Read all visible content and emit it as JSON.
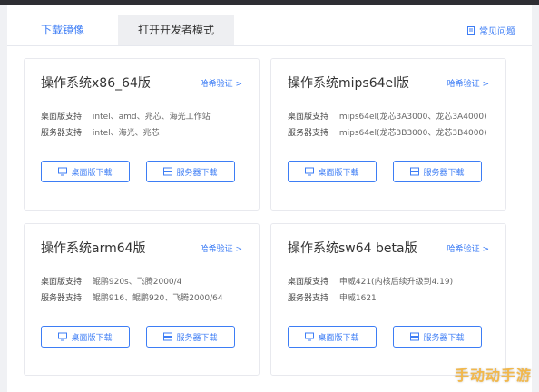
{
  "tabs": [
    {
      "label": "下载镜像",
      "active": true
    },
    {
      "label": "打开开发者模式",
      "active": false
    }
  ],
  "help": {
    "label": "常见问题"
  },
  "cards": [
    {
      "title": "操作系统x86_64版",
      "verify": "哈希验证 >",
      "desktop_label": "桌面版支持",
      "desktop_value": "intel、amd、兆芯、海光工作站",
      "server_label": "服务器支持",
      "server_value": "intel、海光、兆芯",
      "desktop_btn": "桌面版下载",
      "server_btn": "服务器下载"
    },
    {
      "title": "操作系统mips64el版",
      "verify": "哈希验证 >",
      "desktop_label": "桌面版支持",
      "desktop_value": "mips64el(龙芯3A3000、龙芯3A4000)",
      "server_label": "服务器支持",
      "server_value": "mips64el(龙芯3B3000、龙芯3B4000)",
      "desktop_btn": "桌面版下载",
      "server_btn": "服务器下载"
    },
    {
      "title": "操作系统arm64版",
      "verify": "哈希验证 >",
      "desktop_label": "桌面版支持",
      "desktop_value": "鲲鹏920s、飞腾2000/4",
      "server_label": "服务器支持",
      "server_value": "鲲鹏916、鲲鹏920、飞腾2000/64",
      "desktop_btn": "桌面版下载",
      "server_btn": "服务器下载"
    },
    {
      "title": "操作系统sw64 beta版",
      "verify": "哈希验证 >",
      "desktop_label": "桌面版支持",
      "desktop_value": "申威421(内核后续升级到4.19)",
      "server_label": "服务器支持",
      "server_value": "申威1621",
      "desktop_btn": "桌面版下载",
      "server_btn": "服务器下载"
    }
  ],
  "watermark": "手动动手游",
  "colors": {
    "accent": "#3d7df5",
    "watermark": "#f2b84b"
  }
}
